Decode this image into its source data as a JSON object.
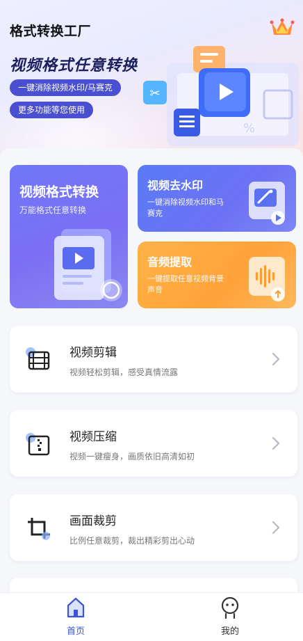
{
  "header": {
    "app_title": "格式转换工厂",
    "crown_icon": "crown-icon"
  },
  "hero": {
    "headline": "视频格式任意转换",
    "pill_1": "一键消除视频水印/马赛克",
    "pill_2": "更多功能等您使用"
  },
  "feature_cards": {
    "convert": {
      "title": "视频格式转换",
      "subtitle": "万能格式任意转换",
      "icon": "video-file-icon"
    },
    "watermark": {
      "title": "视频去水印",
      "subtitle": "一键消除视频水印和马赛克",
      "icon": "magic-wand-icon"
    },
    "audio": {
      "title": "音频提取",
      "subtitle": "一键提取任意视频背景声音",
      "icon": "audio-wave-icon"
    }
  },
  "tools": [
    {
      "title": "视频剪辑",
      "subtitle": "视频轻松剪辑，感受真情流露",
      "icon": "film-icon"
    },
    {
      "title": "视频压缩",
      "subtitle": "视频一键瘦身，画质依旧高清如初",
      "icon": "compress-icon"
    },
    {
      "title": "画面裁剪",
      "subtitle": "比例任意裁剪，裁出精彩剪出心动",
      "icon": "crop-icon"
    }
  ],
  "bottom_nav": {
    "home": "首页",
    "me": "我的"
  },
  "colors": {
    "accent": "#3b55d6",
    "pill": "#4a4fd1",
    "card_purple": "#7c6ff3",
    "card_blue": "#5a7bf5",
    "card_orange": "#ffa239"
  }
}
